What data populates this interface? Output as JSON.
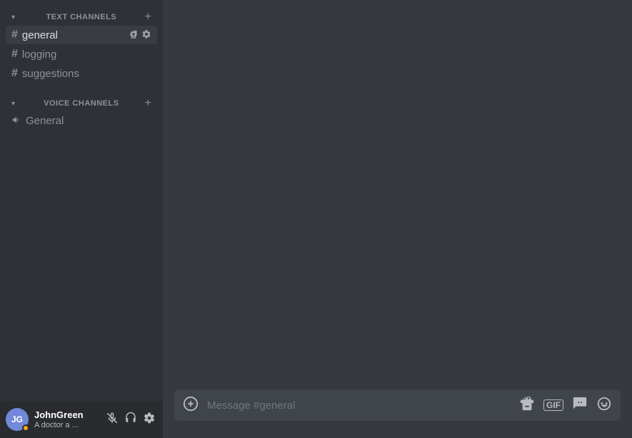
{
  "sidebar": {
    "text_channels_label": "TEXT CHANNELS",
    "voice_channels_label": "VOICE CHANNELS",
    "text_channels": [
      {
        "name": "general",
        "active": true
      },
      {
        "name": "logging",
        "active": false
      },
      {
        "name": "suggestions",
        "active": false
      }
    ],
    "voice_channels": [
      {
        "name": "General"
      }
    ]
  },
  "user": {
    "name": "JohnGreen",
    "status": "A doctor a ...",
    "initials": "JG"
  },
  "message_input": {
    "placeholder": "Message #general"
  },
  "icons": {
    "add_channel": "+",
    "add_voice_channel": "+",
    "invite_icon": "👤+",
    "settings_icon": "⚙",
    "mute_icon": "🎙",
    "deafen_icon": "🎧",
    "user_settings_icon": "⚙"
  }
}
